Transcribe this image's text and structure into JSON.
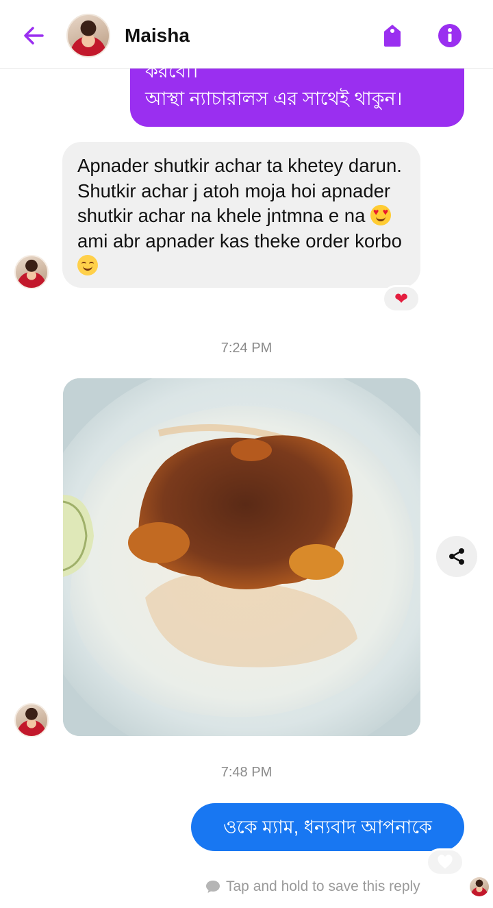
{
  "header": {
    "contact_name": "Maisha",
    "back_icon": "arrow-left-icon",
    "tag_icon": "tag-icon",
    "info_icon": "info-icon",
    "accent_color": "#9a2ff0"
  },
  "messages": {
    "outgoing_purple": {
      "line1": "করবো।",
      "line2": "আস্থা ন্যাচারালস এর সাথেই থাকুন।",
      "color": "#9a2ff0"
    },
    "incoming_text": {
      "part1": "Apnader shutkir achar ta khetey darun. Shutkir achar j  atoh moja hoi apnader shutkir achar na khele jntmna e na ",
      "part2": "ami abr apnader kas theke order korbo ",
      "emoji1": "heart-eyes-emoji",
      "emoji2": "smiling-face-emoji",
      "reaction": "❤"
    },
    "time1": "7:24 PM",
    "incoming_photo": {
      "description_icon": "food-photo",
      "share_icon": "share-icon"
    },
    "time2": "7:48 PM",
    "outgoing_blue": {
      "text": "ওকে ম্যাম, ধন্যবাদ আপনাকে",
      "color": "#1877f2"
    },
    "save_hint": "Tap and hold to save this reply"
  }
}
